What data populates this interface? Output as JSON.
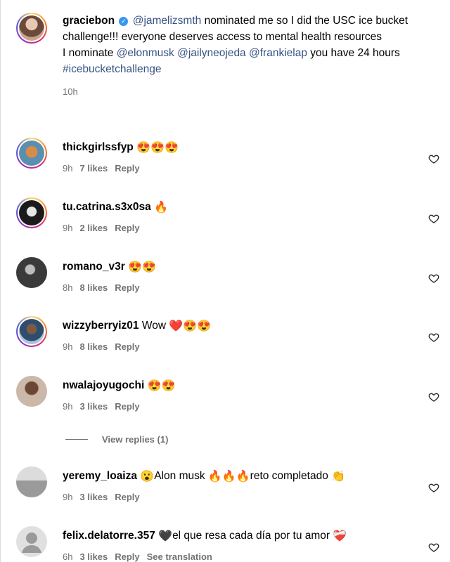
{
  "post": {
    "username": "graciebon",
    "mention1": "@jamelizsmth",
    "text1": " nominated me so I did the USC ice bucket challenge!!! everyone deserves access to mental health resources",
    "text2": "I nominate ",
    "mention2": "@elonmusk",
    "mention3": "@jailyneojeda",
    "mention4": "@frankielap",
    "text3": " you have 24 hours ",
    "hashtag": "#icebucketchallenge",
    "time": "10h"
  },
  "comments": [
    {
      "username": "thickgirlssfyp",
      "text": "",
      "emoji": "😍😍😍",
      "time": "9h",
      "likes": "7 likes",
      "reply": "Reply"
    },
    {
      "username": "tu.catrina.s3x0sa",
      "text": "",
      "emoji": "🔥",
      "time": "9h",
      "likes": "2 likes",
      "reply": "Reply"
    },
    {
      "username": "romano_v3r",
      "text": "",
      "emoji": "😍😍",
      "time": "8h",
      "likes": "8 likes",
      "reply": "Reply"
    },
    {
      "username": "wizzyberryiz01",
      "text": "Wow",
      "emoji": "❤️😍😍",
      "time": "9h",
      "likes": "8 likes",
      "reply": "Reply"
    },
    {
      "username": "nwalajoyugochi",
      "text": "",
      "emoji": "😍😍",
      "time": "9h",
      "likes": "3 likes",
      "reply": "Reply"
    },
    {
      "username": "yeremy_loaiza",
      "text_a": "😮",
      "text_b": "Alon musk ",
      "text_c": "🔥🔥🔥",
      "text_d": "reto completado ",
      "text_e": "👏",
      "time": "9h",
      "likes": "3 likes",
      "reply": "Reply"
    },
    {
      "username": "felix.delatorre.357",
      "text_a": "🖤",
      "text_b": "el que resa cada día por tu amor ",
      "text_c": "❤️‍🩹",
      "time": "6h",
      "likes": "3 likes",
      "reply": "Reply",
      "translate": "See translation"
    }
  ],
  "view_replies": "View replies (1)",
  "colors": {
    "link": "#385185",
    "meta": "#737373",
    "verified": "#3897f0"
  }
}
